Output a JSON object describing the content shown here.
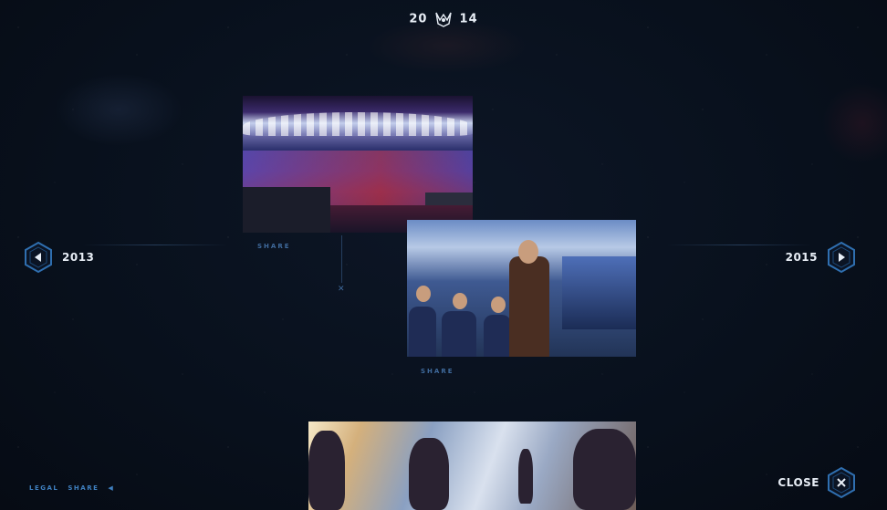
{
  "header": {
    "year_left": "20",
    "year_right": "14",
    "logo_icon": "worlds-crest-icon"
  },
  "nav": {
    "prev_label": "2013",
    "next_label": "2015",
    "prev_icon": "chevron-left-icon",
    "next_icon": "chevron-right-icon"
  },
  "gallery": {
    "items": [
      {
        "share_label": "SHARE"
      },
      {
        "share_label": "SHARE"
      },
      {
        "share_label": ""
      }
    ]
  },
  "footer": {
    "legal_label": "LEGAL",
    "share_label": "SHARE",
    "share_icon": "caret-left-icon",
    "close_label": "CLOSE",
    "close_icon": "close-icon"
  },
  "colors": {
    "background": "#08101c",
    "accent": "#3f80c0",
    "hex_border": "#2f6fb0",
    "text": "#e8eef6"
  }
}
